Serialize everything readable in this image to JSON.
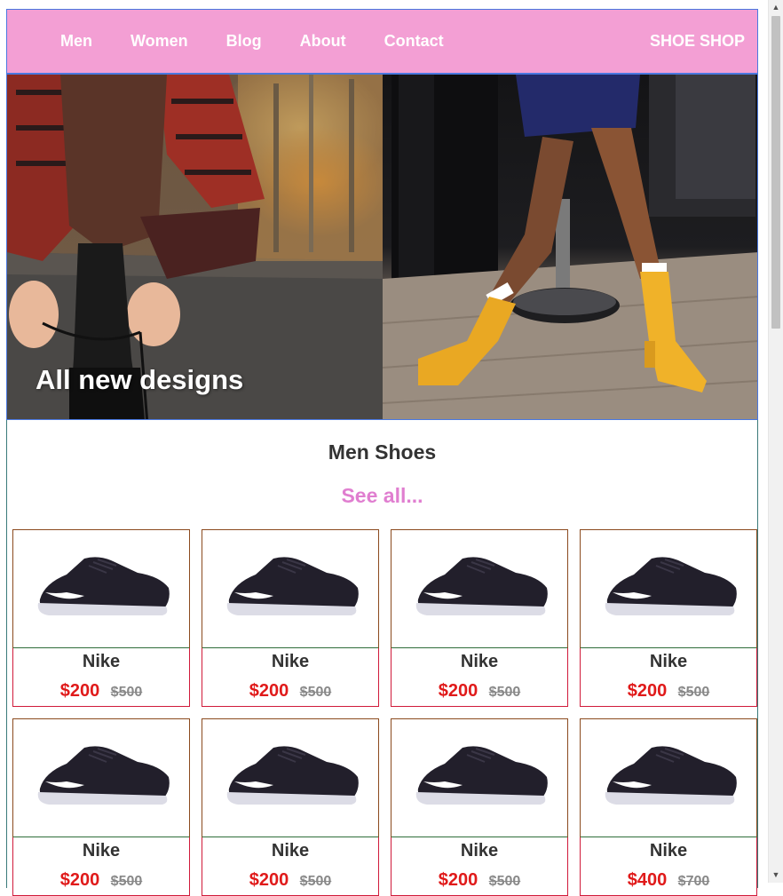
{
  "nav": {
    "links": [
      "Men",
      "Women",
      "Blog",
      "About",
      "Contact"
    ],
    "brand": "SHOE SHOP"
  },
  "hero": {
    "caption": "All new designs"
  },
  "section": {
    "title": "Men Shoes",
    "see_all": "See all..."
  },
  "products": [
    {
      "name": "Nike",
      "price": "$200",
      "old_price": "$500"
    },
    {
      "name": "Nike",
      "price": "$200",
      "old_price": "$500"
    },
    {
      "name": "Nike",
      "price": "$200",
      "old_price": "$500"
    },
    {
      "name": "Nike",
      "price": "$200",
      "old_price": "$500"
    },
    {
      "name": "Nike",
      "price": "$200",
      "old_price": "$500"
    },
    {
      "name": "Nike",
      "price": "$200",
      "old_price": "$500"
    },
    {
      "name": "Nike",
      "price": "$200",
      "old_price": "$500"
    },
    {
      "name": "Nike",
      "price": "$400",
      "old_price": "$700"
    }
  ],
  "colors": {
    "nav_bg": "#f39fd4",
    "accent_pink": "#e07ed0",
    "price_red": "#e01a1a"
  }
}
